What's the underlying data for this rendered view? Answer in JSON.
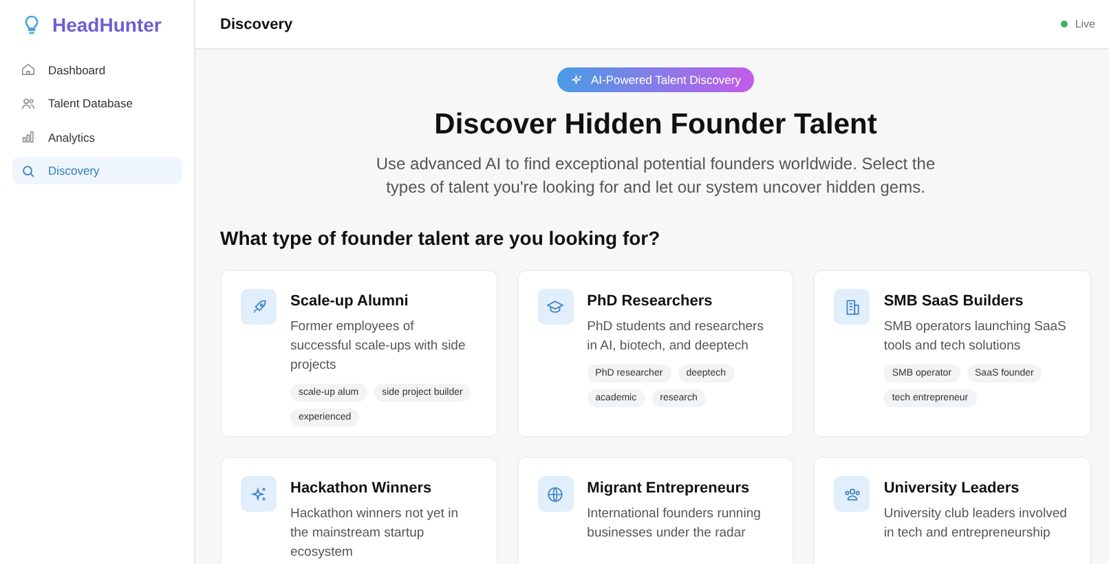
{
  "sidebar": {
    "logo": "HeadHunter",
    "items": [
      {
        "label": "Dashboard",
        "kind": "home",
        "selected": false
      },
      {
        "label": "Talent Database",
        "kind": "users",
        "selected": false
      },
      {
        "label": "Analytics",
        "kind": "chart",
        "selected": false
      },
      {
        "label": "Discovery",
        "kind": "search",
        "selected": true
      }
    ]
  },
  "header": {
    "title": "Discovery",
    "status": "Live"
  },
  "hero": {
    "badge": "AI-Powered Talent Discovery",
    "title": "Discover Hidden Founder Talent",
    "subtitle": "Use advanced AI to find exceptional potential founders worldwide. Select the types of talent you're looking for and let our system uncover hidden gems."
  },
  "section_title": "What type of founder talent are you looking for?",
  "cards": [
    {
      "kind": "rocket",
      "title": "Scale-up Alumni",
      "description": "Former employees of successful scale-ups with side projects",
      "tags": [
        "scale-up alum",
        "side project builder",
        "experienced"
      ]
    },
    {
      "kind": "cap",
      "title": "PhD Researchers",
      "description": "PhD students and researchers in AI, biotech, and deeptech",
      "tags": [
        "PhD researcher",
        "deeptech",
        "academic",
        "research"
      ]
    },
    {
      "kind": "building",
      "title": "SMB SaaS Builders",
      "description": "SMB operators launching SaaS tools and tech solutions",
      "tags": [
        "SMB operator",
        "SaaS founder",
        "tech entrepreneur"
      ]
    },
    {
      "kind": "sparkles",
      "title": "Hackathon Winners",
      "description": "Hackathon winners not yet in the mainstream startup ecosystem"
    },
    {
      "kind": "globe",
      "title": "Migrant Entrepreneurs",
      "description": "International founders running businesses under the radar"
    },
    {
      "kind": "people",
      "title": "University Leaders",
      "description": "University club leaders involved in tech and entrepreneurship"
    }
  ]
}
